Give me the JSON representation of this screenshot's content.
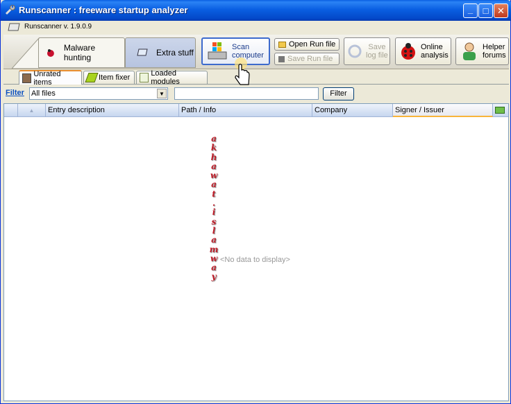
{
  "window": {
    "title": "Runscanner : freeware startup analyzer",
    "minimize": "_",
    "maximize": "□",
    "close": "✕"
  },
  "version": {
    "text": "Runscanner v. 1.9.0.9"
  },
  "main_tabs": [
    {
      "label": "Malware hunting",
      "icon": "bug-icon",
      "active": true
    },
    {
      "label": "Extra stuff",
      "icon": "eraser-icon",
      "active": false
    }
  ],
  "toolbar": {
    "scan_line1": "Scan",
    "scan_line2": "computer",
    "open_run_file": "Open Run file",
    "save_run_file": "Save Run file",
    "save_log_line1": "Save",
    "save_log_line2": "log file",
    "online_line1": "Online",
    "online_line2": "analysis",
    "helper_line1": "Helper",
    "helper_line2": "forums"
  },
  "sub_tabs": [
    {
      "label": "Unrated items",
      "icon": "user-icon",
      "active": true
    },
    {
      "label": "Item fixer",
      "icon": "pencil-icon",
      "active": false
    },
    {
      "label": "Loaded modules",
      "icon": "module-icon",
      "active": false
    }
  ],
  "filter": {
    "label": "Filter",
    "combo_value": "All files",
    "text_value": "",
    "button": "Filter"
  },
  "grid": {
    "sort_indicator": "▲",
    "columns": [
      "Entry description",
      "Path / Info",
      "Company",
      "Signer / Issuer"
    ],
    "empty_message": "<No data to display>"
  },
  "watermark": [
    "a",
    "k",
    "h",
    "a",
    "w",
    "a",
    "t",
    ".",
    "i",
    "s",
    "l",
    "a",
    "m",
    "w",
    "a",
    "y"
  ],
  "colors": {
    "titlebar": "#0a5fe2",
    "watermark": "#c01e2a",
    "filter_link": "#0b50c0"
  }
}
